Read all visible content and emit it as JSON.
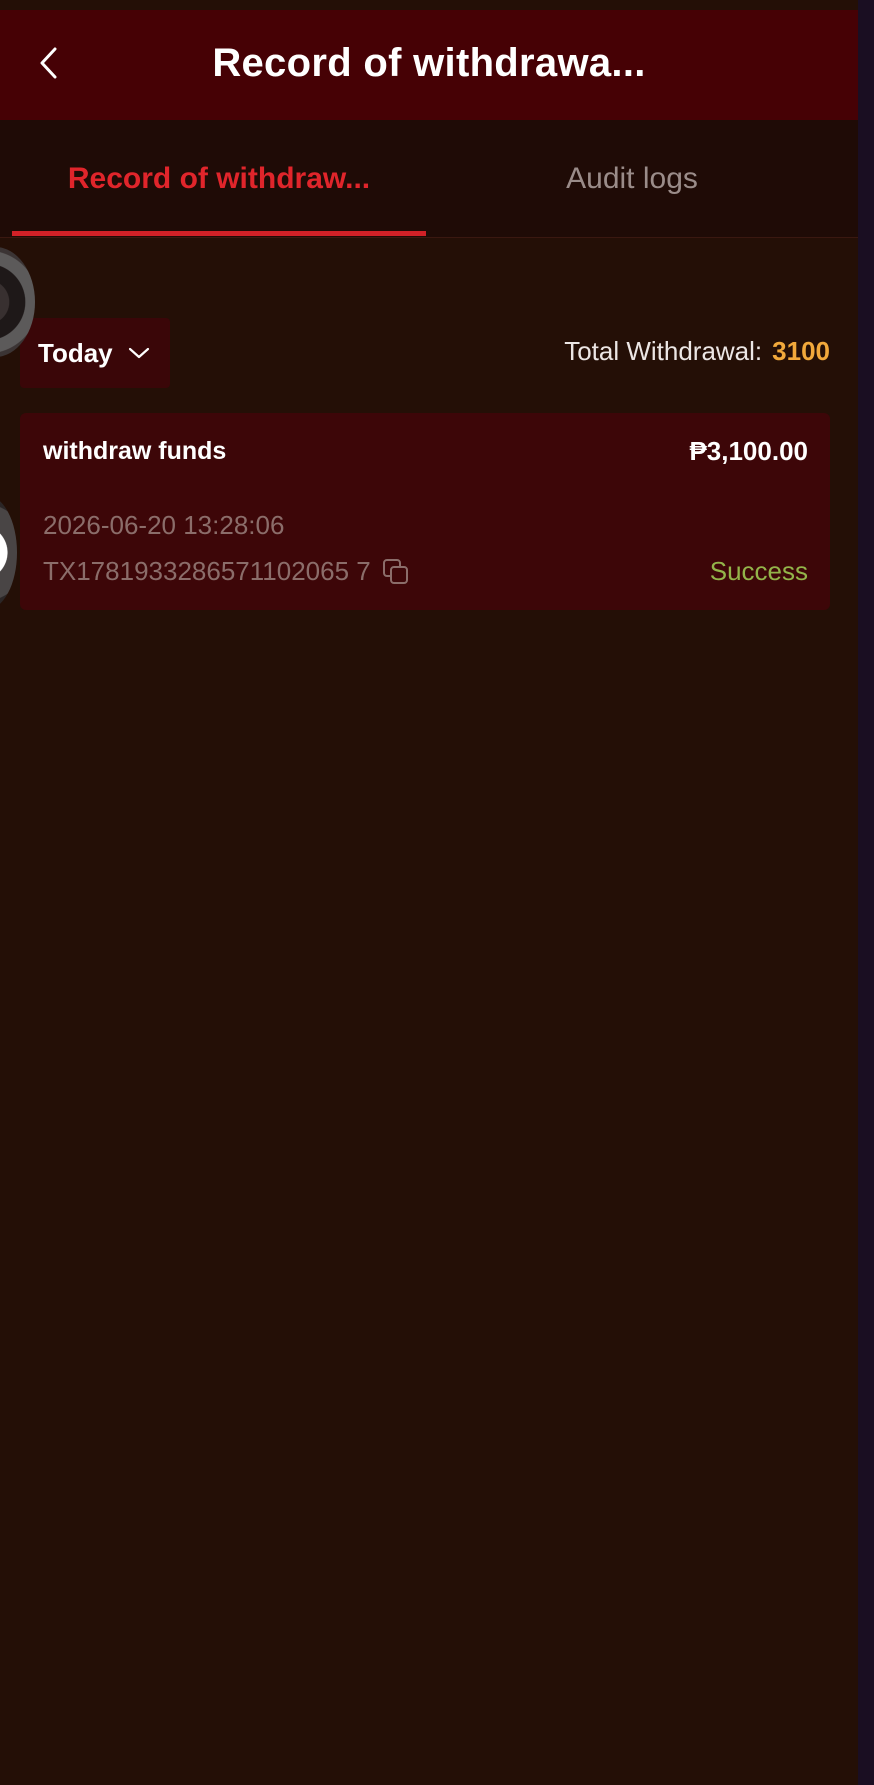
{
  "header": {
    "title": "Record of withdrawa...",
    "back_icon": "chevron-left-icon"
  },
  "tabs": [
    {
      "label": "Record of withdraw...",
      "active": true
    },
    {
      "label": "Audit logs",
      "active": false
    }
  ],
  "filter": {
    "selected": "Today",
    "icon": "chevron-down-icon"
  },
  "summary": {
    "total_label": "Total Withdrawal:",
    "total_value": "3100"
  },
  "records": [
    {
      "title": "withdraw funds",
      "amount": "₱3,100.00",
      "time": "2026-06-20 13:28:06",
      "txid": "TX1781933286571102065 7",
      "status": "Success"
    }
  ],
  "colors": {
    "accent_red": "#e0252b",
    "total_value": "#f2a93b",
    "status_success": "#93b44a",
    "header_bg": "#460105",
    "card_bg": "#3d0608"
  }
}
